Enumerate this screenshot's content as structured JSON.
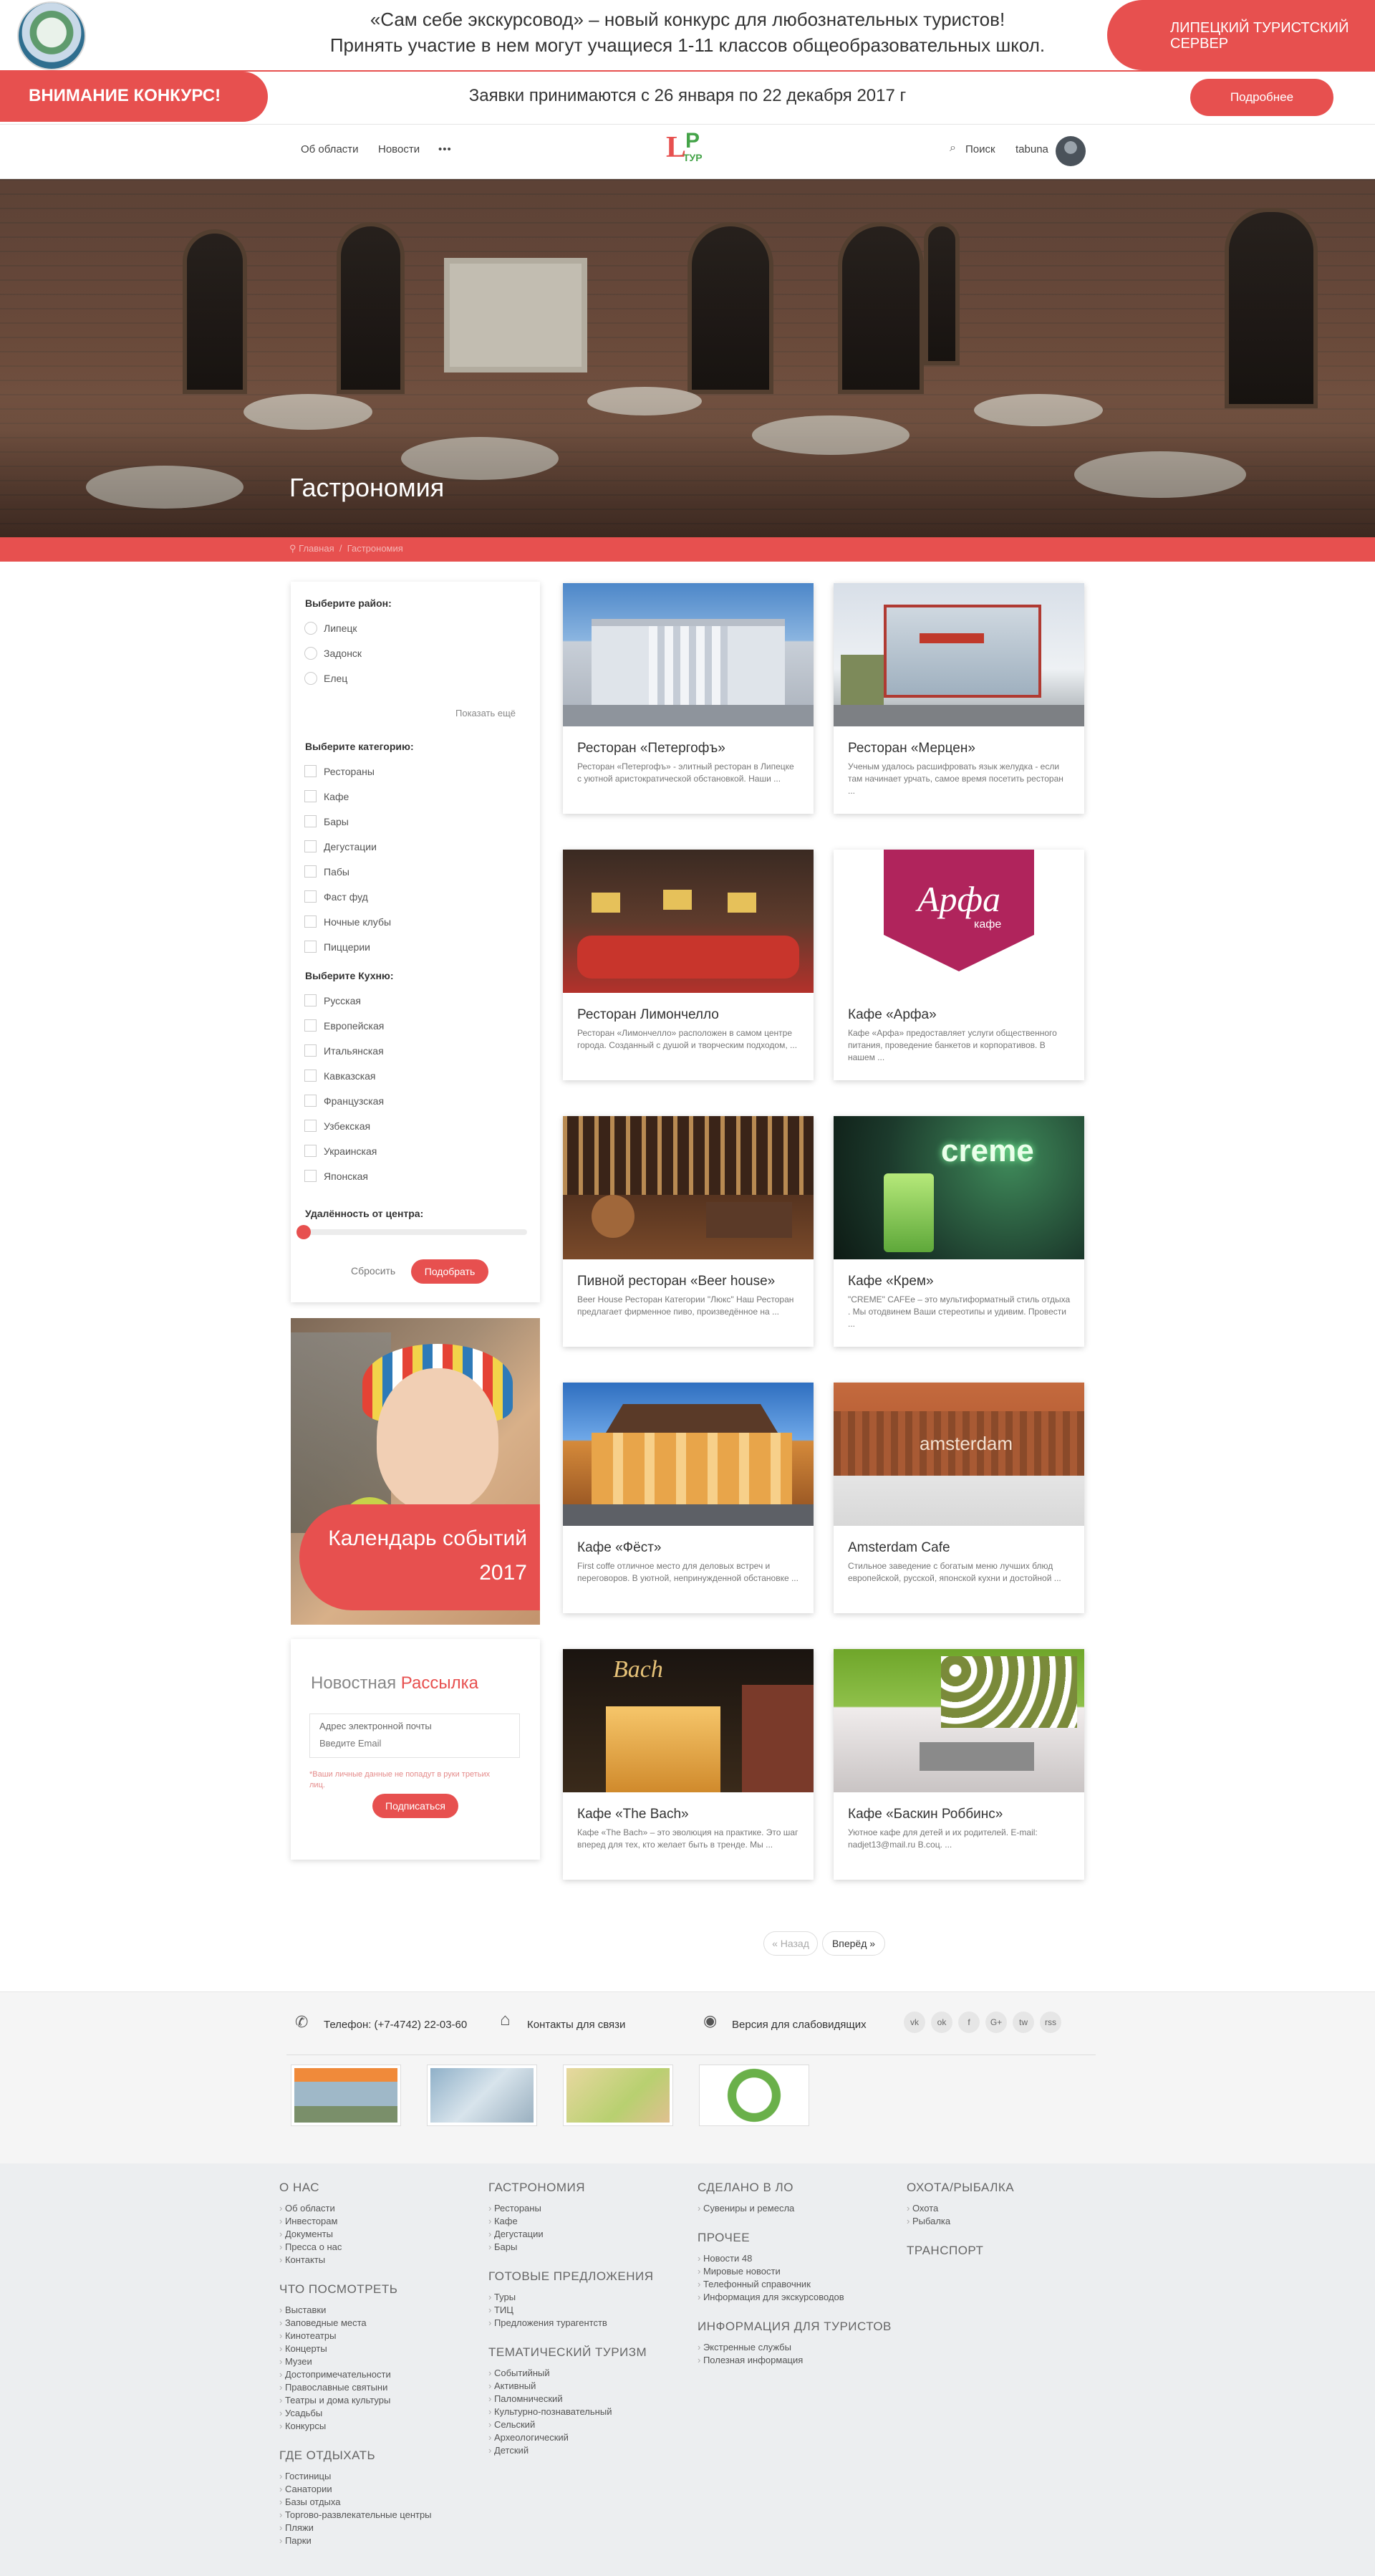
{
  "top_banner": {
    "line1": "«Сам себе экскурсовод» – новый конкурс для любознательных туристов!",
    "line2": "Принять участие в нем могут учащиеся 1-11 классов общеобразовательных школ.",
    "server_label": "ЛИПЕЦКИЙ ТУРИСТСКИЙ СЕРВЕР"
  },
  "contest": {
    "label": "ВНИМАНИЕ КОНКУРС!",
    "dates": "Заявки принимаются с 26 января по 22 декабря 2017 г",
    "more_button": "Подробнее"
  },
  "nav": {
    "links": [
      "Об области",
      "Новости",
      "•••"
    ],
    "logo_letters": {
      "l": "L",
      "p": "P",
      "tur": "ТУР"
    },
    "search_icon": "⌕",
    "search_label": "Поиск",
    "username": "tabuna"
  },
  "hero": {
    "title": "Гастрономия",
    "breadcrumb_home": "Главная",
    "breadcrumb_current": "Гастрономия"
  },
  "filters": {
    "district_heading": "Выберите район:",
    "districts": [
      "Липецк",
      "Задонск",
      "Елец"
    ],
    "show_more": "Показать ещё",
    "category_heading": "Выберите категорию:",
    "categories": [
      "Рестораны",
      "Кафе",
      "Бары",
      "Дегустации",
      "Пабы",
      "Фаст фуд",
      "Ночные клубы",
      "Пиццерии"
    ],
    "cuisine_heading": "Выберите Кухню:",
    "cuisines": [
      "Русская",
      "Европейская",
      "Итальянская",
      "Кавказская",
      "Французская",
      "Узбекская",
      "Украинская",
      "Японская"
    ],
    "distance_heading": "Удалённость от центра:",
    "distance_value": 0,
    "reset_label": "Сбросить",
    "apply_label": "Подобрать"
  },
  "calendar_banner": {
    "text": "Календарь событий 2017"
  },
  "newsletter": {
    "title_plain": "Новостная",
    "title_accent": "Рассылка",
    "field_label": "Адрес электронной почты",
    "field_placeholder": "Введите Email",
    "note": "*Ваши личные данные не попадут в руки третьих лиц.",
    "button": "Подписаться"
  },
  "cards": [
    {
      "title": "Ресторан «Петергофъ»",
      "desc": "Ресторан «Петергофъ» - элитный ресторан в Липецке с уютной аристократической обстановкой. Наши ..."
    },
    {
      "title": "Ресторан «Мерцен»",
      "desc": "Ученым удалось расшифровать язык желудка - если там начинает урчать, самое время посетить ресторан ..."
    },
    {
      "title": "Ресторан Лимончелло",
      "desc": "Ресторан «Лимончелло» расположен в самом центре города. Созданный с душой и творческим подходом, ..."
    },
    {
      "title": "Кафе «Арфа»",
      "desc": "Кафе «Арфа» предоставляет услуги общественного питания, проведение банкетов и корпоративов. В нашем ...",
      "logo_main": "Арфа",
      "logo_sub": "кафе"
    },
    {
      "title": "Пивной ресторан «Beer house»",
      "desc": "Beer House Ресторан Категории \"Люкс\" Наш Ресторан предлагает фирменное пиво, произведённое на ..."
    },
    {
      "title": "Кафе «Крем»",
      "desc": "\"CREME\" CAFEe – это мультиформатный стиль отдыха . Мы отодвинем Ваши стереотипы и удивим. Провести ...",
      "sign_text": "creme"
    },
    {
      "title": "Кафе «Фёст»",
      "desc": "First coffe отличное место для деловых встреч и переговоров. В уютной, непринужденной обстановке ..."
    },
    {
      "title": "Amsterdam Cafe",
      "desc": "Стильное заведение с богатым меню лучших блюд европейской, русской, японской кухни и достойной ...",
      "sign_text": "amsterdam"
    },
    {
      "title": "Кафе «The Bach»",
      "desc": "Кафе «The Bach» – это эволюция на практике. Это шаг вперед для тех, кто желает быть в тренде.  Мы ...",
      "sign_text": "Bach"
    },
    {
      "title": "Кафе «Баскин Роббинс»",
      "desc": "Уютное кафе для детей и их родителей. E-mail: nadjet13@mail.ru В.соц. ..."
    }
  ],
  "pagination": {
    "prev": "« Назад",
    "next": "Вперёд »"
  },
  "contacts": {
    "phone": "Телефон: (+7-4742) 22-03-60",
    "contacts_link": "Контакты для связи",
    "accessibility": "Версия для слабовидящих",
    "social": [
      "vk",
      "ok",
      "f",
      "G+",
      "tw",
      "rss"
    ]
  },
  "footer": {
    "columns": [
      [
        {
          "heading": "О НАС",
          "items": [
            "Об области",
            "Инвесторам",
            "Документы",
            "Пресса о нас",
            "Контакты"
          ]
        },
        {
          "heading": "ЧТО ПОСМОТРЕТЬ",
          "items": [
            "Выставки",
            "Заповедные места",
            "Кинотеатры",
            "Концерты",
            "Музеи",
            "Достопримечательности",
            "Православные святыни",
            "Театры и дома культуры",
            "Усадьбы",
            "Конкурсы"
          ]
        },
        {
          "heading": "ГДЕ ОТДЫХАТЬ",
          "items": [
            "Гостиницы",
            "Санатории",
            "Базы отдыха",
            "Торгово-развлекательные центры",
            "Пляжи",
            "Парки"
          ]
        }
      ],
      [
        {
          "heading": "ГАСТРОНОМИЯ",
          "items": [
            "Рестораны",
            "Кафе",
            "Дегустации",
            "Бары"
          ]
        },
        {
          "heading": "ГОТОВЫЕ ПРЕДЛОЖЕНИЯ",
          "items": [
            "Туры",
            "ТИЦ",
            "Предложения турагентств"
          ]
        },
        {
          "heading": "ТЕМАТИЧЕСКИЙ ТУРИЗМ",
          "items": [
            "Событийный",
            "Активный",
            "Паломнический",
            "Культурно-познавательный",
            "Сельский",
            "Археологический",
            "Детский"
          ]
        }
      ],
      [
        {
          "heading": "СДЕЛАНО В ЛО",
          "items": [
            "Сувениры и ремесла"
          ]
        },
        {
          "heading": "ПРОЧЕЕ",
          "items": [
            "Новости 48",
            "Мировые новости",
            "Телефонный справочник",
            "Информация для экскурсоводов"
          ]
        },
        {
          "heading": "ИНФОРМАЦИЯ ДЛЯ ТУРИСТОВ",
          "items": [
            "Экстренные службы",
            "Полезная информация"
          ]
        }
      ],
      [
        {
          "heading": "ОХОТА/РЫБАЛКА",
          "items": [
            "Охота",
            "Рыбалка"
          ]
        },
        {
          "heading": "ТРАНСПОРТ",
          "items": []
        }
      ]
    ]
  }
}
